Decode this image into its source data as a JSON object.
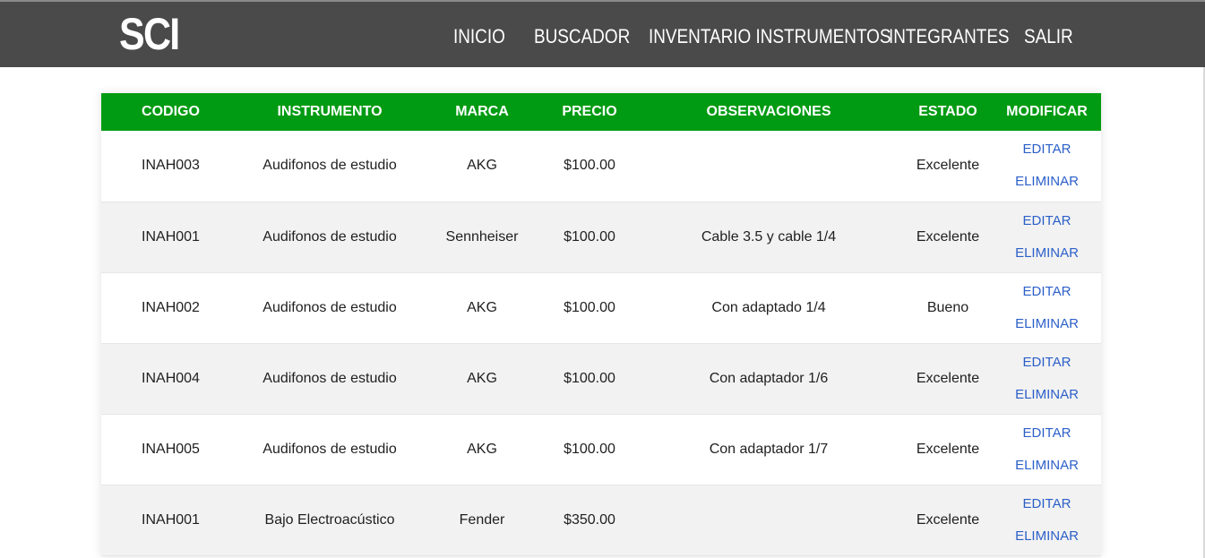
{
  "brand": "SCI",
  "nav": [
    "INICIO",
    "BUSCADOR",
    "INVENTARIO INSTRUMENTOS",
    "INTEGRANTES",
    "SALIR"
  ],
  "table": {
    "headers": [
      "CODIGO",
      "INSTRUMENTO",
      "MARCA",
      "PRECIO",
      "OBSERVACIONES",
      "ESTADO",
      "MODIFICAR"
    ],
    "edit_label": "EDITAR",
    "delete_label": "ELIMINAR",
    "rows": [
      {
        "codigo": "INAH003",
        "instrumento": "Audifonos de estudio",
        "marca": "AKG",
        "precio": "$100.00",
        "observaciones": "",
        "estado": "Excelente"
      },
      {
        "codigo": "INAH001",
        "instrumento": "Audifonos de estudio",
        "marca": "Sennheiser",
        "precio": "$100.00",
        "observaciones": "Cable 3.5 y cable 1/4",
        "estado": "Excelente"
      },
      {
        "codigo": "INAH002",
        "instrumento": "Audifonos de estudio",
        "marca": "AKG",
        "precio": "$100.00",
        "observaciones": "Con adaptado 1/4",
        "estado": "Bueno"
      },
      {
        "codigo": "INAH004",
        "instrumento": "Audifonos de estudio",
        "marca": "AKG",
        "precio": "$100.00",
        "observaciones": "Con adaptador 1/6",
        "estado": "Excelente"
      },
      {
        "codigo": "INAH005",
        "instrumento": "Audifonos de estudio",
        "marca": "AKG",
        "precio": "$100.00",
        "observaciones": "Con adaptador 1/7",
        "estado": "Excelente"
      },
      {
        "codigo": "INAH001",
        "instrumento": "Bajo Electroacústico",
        "marca": "Fender",
        "precio": "$350.00",
        "observaciones": "",
        "estado": "Excelente"
      }
    ]
  },
  "colors": {
    "navbar": "#4a4a4a",
    "header": "#009b12",
    "link": "#2b5fc9",
    "alt_row": "#f2f2f2"
  }
}
